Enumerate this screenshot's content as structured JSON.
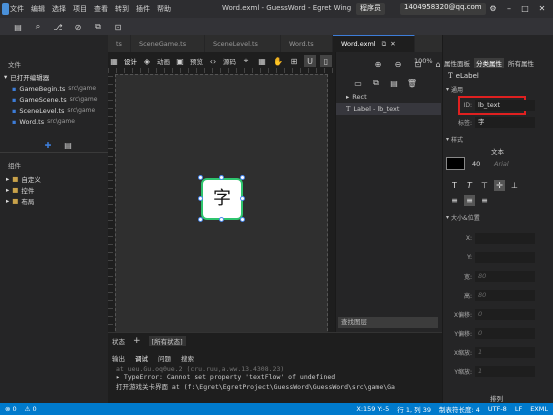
{
  "menu": [
    "文件",
    "编辑",
    "选择",
    "项目",
    "查看",
    "转到",
    "插件",
    "帮助"
  ],
  "window_title": "Word.exml - GuessWord - Egret Wing",
  "role": "程序员",
  "email": "1404958320@qq.com",
  "sidebar": {
    "section_files": "文件",
    "open_editors_label": "已打开编辑器",
    "open_files": [
      {
        "name": "GameBegin.ts",
        "path": "src\\game"
      },
      {
        "name": "GameScene.ts",
        "path": "src\\game"
      },
      {
        "name": "SceneLevel.ts",
        "path": "src\\game"
      },
      {
        "name": "Word.ts",
        "path": "src\\game"
      }
    ],
    "section_components": "组件",
    "components": [
      "自定义",
      "控件",
      "布局"
    ]
  },
  "tabs": [
    {
      "label": "ts"
    },
    {
      "label": "SceneGame.ts"
    },
    {
      "label": "SceneLevel.ts"
    },
    {
      "label": "Word.ts"
    },
    {
      "label": "Word.exml",
      "active": true
    }
  ],
  "editor_toolbar": {
    "design": "设计",
    "animation": "动画",
    "preview": "预览",
    "source": "源码",
    "zoom": "100%"
  },
  "widget": {
    "text": "字"
  },
  "layers": {
    "items": [
      "Rect",
      "Label - lb_text"
    ],
    "search_placeholder": "查找图层"
  },
  "right_panel": {
    "tabs": [
      "属性面板",
      "分类属性",
      "所有属性"
    ],
    "component": "eLabel",
    "section_common": "通用",
    "id_label": "ID:",
    "id_value": "lb_text",
    "title_label": "标签:",
    "title_value": "字",
    "section_style": "样式",
    "text_label": "文本",
    "font_size": "40",
    "font_name": "Arial",
    "section_size": "大小&位置",
    "fields": [
      {
        "label": "X:",
        "value": ""
      },
      {
        "label": "Y:",
        "value": ""
      },
      {
        "label": "宽:",
        "value": "80"
      },
      {
        "label": "高:",
        "value": "80"
      },
      {
        "label": "X偏移:",
        "value": "0"
      },
      {
        "label": "Y偏移:",
        "value": "0"
      },
      {
        "label": "X缩放:",
        "value": "1"
      },
      {
        "label": "Y缩放:",
        "value": "1"
      }
    ],
    "section_arrange": "排列"
  },
  "bottom": {
    "tabs": [
      "状态",
      "+",
      "[所有状态]"
    ],
    "subtabs": [
      "输出",
      "调试",
      "问题",
      "搜索"
    ],
    "log_lines": [
      "at ueu.Gu.oq0ue.2 (cru.ruu,a.ww.13.4308.23)",
      "▸ TypeError: Cannot set property 'textFlow' of undefined",
      "打开游戏关卡界面     at (f:\\Egret\\EgretProject\\GuessWord\\GuessWord\\src\\game\\Ga"
    ]
  },
  "statusbar": {
    "left": [
      "⊗ 0",
      "⚠ 0"
    ],
    "right": [
      "X:159 Y:-5",
      "行 1, 列 39",
      "制表符长度: 4",
      "UTF-8",
      "LF",
      "EXML"
    ]
  }
}
